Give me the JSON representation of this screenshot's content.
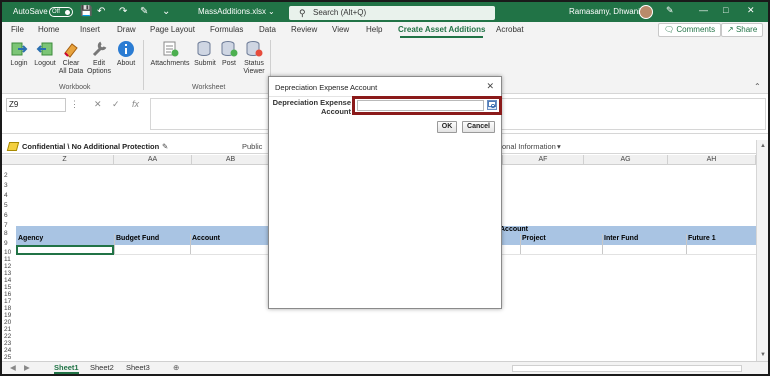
{
  "titlebar": {
    "autosave_label": "AutoSave",
    "autosave_state": "Off",
    "filename": "MassAdditions.xlsx",
    "search_placeholder": "Search (Alt+Q)",
    "user_name": "Ramasamy, Dhwani",
    "accent_color": "#217346"
  },
  "tabs": [
    "File",
    "Home",
    "Insert",
    "Draw",
    "Page Layout",
    "Formulas",
    "Data",
    "Review",
    "View",
    "Help",
    "Create Asset Additions",
    "Acrobat"
  ],
  "active_tab": "Create Asset Additions",
  "comments_label": "Comments",
  "share_label": "Share",
  "ribbon": {
    "workbook_group": "Workbook",
    "worksheet_group": "Worksheet",
    "login": "Login",
    "logout": "Logout",
    "clear_line1": "Clear",
    "clear_line2": "All Data",
    "edit_line1": "Edit",
    "edit_line2": "Options",
    "about": "About",
    "attachments": "Attachments",
    "submit": "Submit",
    "post": "Post",
    "status_line1": "Status",
    "status_line2": "Viewer"
  },
  "formula_bar": {
    "name_box": "Z9",
    "fx": "fx"
  },
  "sensitivity": {
    "label": "Confidential \\ No Additional Protection",
    "public": "Public",
    "info": "onal Information"
  },
  "columns": [
    "Z",
    "AA",
    "AB",
    "AF",
    "AG",
    "AH"
  ],
  "rows": [
    "2",
    "3",
    "4",
    "5",
    "6",
    "7",
    "8",
    "9",
    "10",
    "11",
    "12",
    "13",
    "14",
    "15",
    "16",
    "17",
    "18",
    "19",
    "20",
    "21",
    "22",
    "23",
    "24",
    "25"
  ],
  "band_label": "Account",
  "headers": [
    "Agency",
    "Budget Fund",
    "Account",
    "Project",
    "Inter Fund",
    "Future 1"
  ],
  "sheets": [
    "Sheet1",
    "Sheet2",
    "Sheet3"
  ],
  "dialog": {
    "title": "Depreciation Expense Account",
    "field_label": "Depreciation Expense Account",
    "field_value": "",
    "ok": "OK",
    "cancel": "Cancel"
  }
}
